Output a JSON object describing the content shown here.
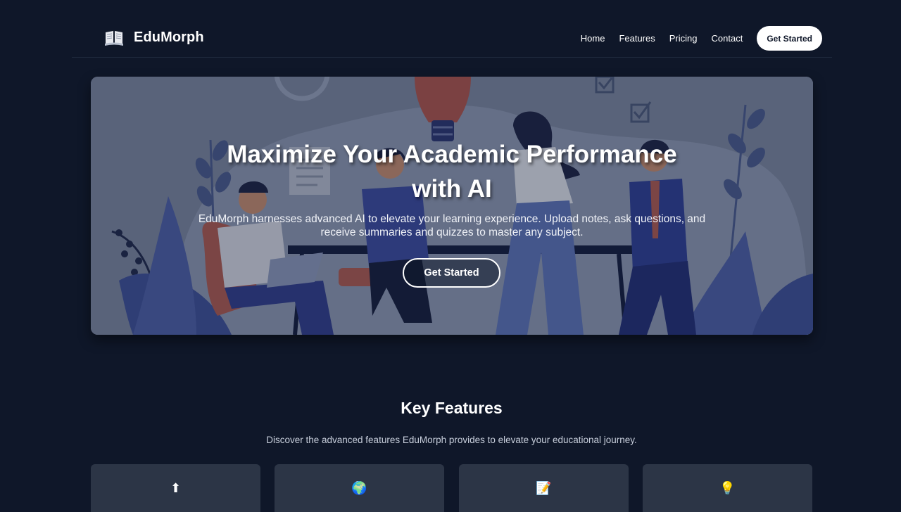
{
  "brand": {
    "name": "EduMorph",
    "logo_icon": "open-book-icon"
  },
  "nav": {
    "links": [
      "Home",
      "Features",
      "Pricing",
      "Contact"
    ],
    "cta": "Get Started"
  },
  "hero": {
    "title_line1": "Maximize Your Academic Performance",
    "title_line2": "with AI",
    "subtitle_line1": "EduMorph harnesses advanced AI to elevate your learning experience. Upload notes, ask questions, and",
    "subtitle_line2": "receive summaries and quizzes to master any subject.",
    "cta": "Get Started",
    "image": "illustration of students collaborating at a desk with laptop, lightbulb, and plants"
  },
  "features": {
    "title": "Key Features",
    "subtitle": "Discover the advanced features EduMorph provides to elevate your educational journey.",
    "cards": [
      {
        "icon": "up-arrow-icon",
        "glyph": "⬆"
      },
      {
        "icon": "globe-icon",
        "glyph": "🌍"
      },
      {
        "icon": "memo-icon",
        "glyph": "📝"
      },
      {
        "icon": "lightbulb-icon",
        "glyph": "💡"
      }
    ]
  },
  "colors": {
    "background": "#0f1729",
    "card": "#2c3546",
    "accent_white": "#ffffff"
  }
}
